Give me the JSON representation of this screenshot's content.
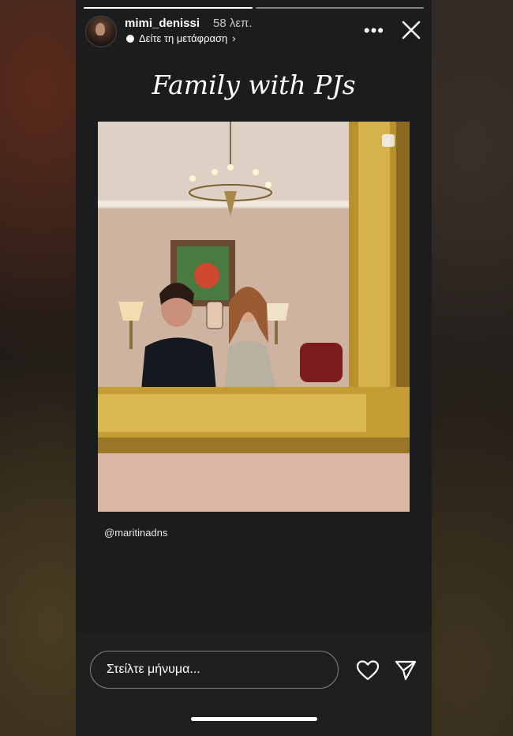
{
  "header": {
    "username": "mimi_denissi",
    "time": "58 λεπ.",
    "translate_label": "Δείτε τη μετάφραση",
    "translate_chevron": "›",
    "more_glyph": "•••"
  },
  "progress": {
    "segments": 2,
    "active_index": 0
  },
  "story": {
    "title": "Family with PJs",
    "mention": "@maritinadns",
    "photo_description_icon": "mirror-selfie-photo"
  },
  "reply": {
    "placeholder": "Στείλτε μήνυμα..."
  },
  "icons": {
    "more": "more-options-icon",
    "close": "close-icon",
    "like": "heart-icon",
    "send": "send-icon"
  },
  "colors": {
    "background": "#1b1c1e",
    "text": "#ffffff",
    "gold_frame": "#c9a33c"
  }
}
